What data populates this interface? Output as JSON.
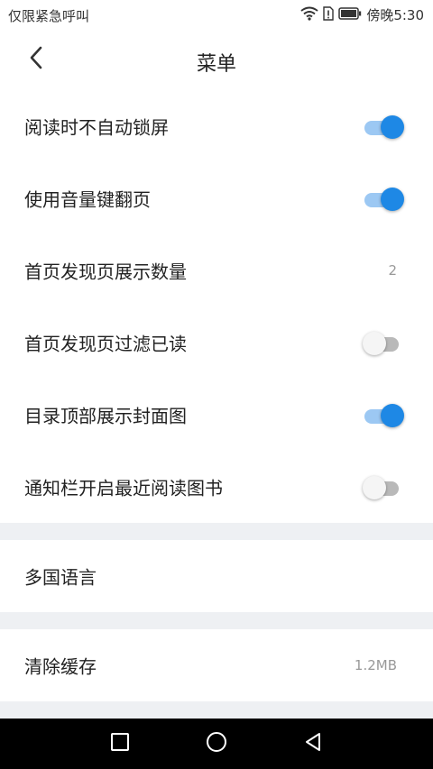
{
  "status_bar": {
    "left_text": "仅限紧急呼叫",
    "time": "傍晚5:30",
    "icons": [
      "wifi-icon",
      "sim-alert-icon",
      "battery-icon"
    ]
  },
  "header": {
    "title": "菜单",
    "back_icon": "chevron-left-icon"
  },
  "settings": [
    {
      "label": "阅读时不自动锁屏",
      "type": "toggle",
      "on": true
    },
    {
      "label": "使用音量键翻页",
      "type": "toggle",
      "on": true
    },
    {
      "label": "首页发现页展示数量",
      "type": "value",
      "value": "2"
    },
    {
      "label": "首页发现页过滤已读",
      "type": "toggle",
      "on": false
    },
    {
      "label": "目录顶部展示封面图",
      "type": "toggle",
      "on": true
    },
    {
      "label": "通知栏开启最近阅读图书",
      "type": "toggle",
      "on": false
    }
  ],
  "language": {
    "label": "多国语言"
  },
  "cache": {
    "label": "清除缓存",
    "value": "1.2MB"
  },
  "colors": {
    "accent": "#1e88e5",
    "accent_track": "#9cc8f3",
    "section_gap": "#eef0f3"
  },
  "system_nav": [
    "recent-apps-icon",
    "home-icon",
    "back-triangle-icon"
  ]
}
